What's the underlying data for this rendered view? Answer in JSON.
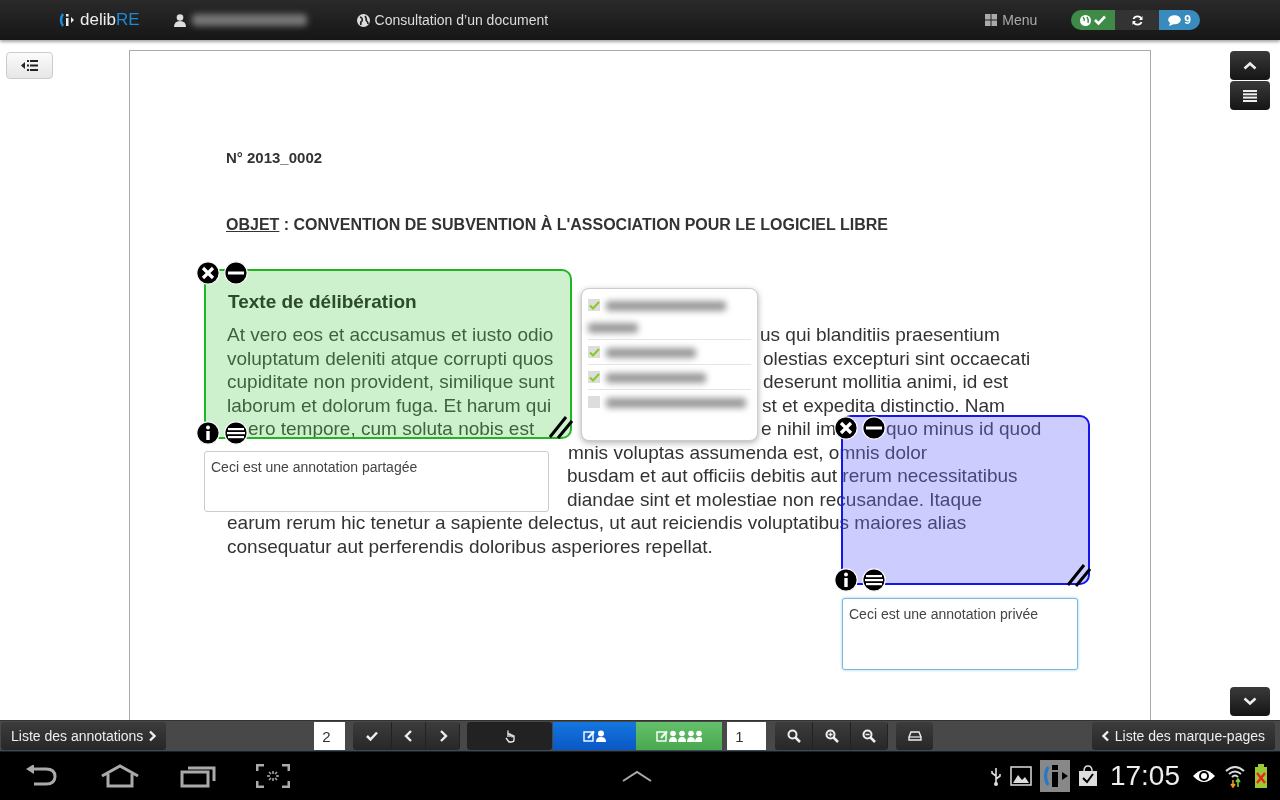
{
  "top_bar": {
    "logo": "delib",
    "logo_accent": "RE",
    "page_title": "Consultation d’un document",
    "menu": "Menu",
    "message_count": "9"
  },
  "document": {
    "number": "N° 2013_0002",
    "subject_label": "OBJET",
    "subject": " : CONVENTION DE SUBVENTION À L'ASSOCIATION POUR LE LOGICIEL LIBRE",
    "lines": [
      [
        "At vero eos et accusamus et iusto odio",
        "us qui blanditiis praesentium"
      ],
      [
        "voluptatum deleniti atque corrupti quos",
        "olestias excepturi sint occaecati"
      ],
      [
        "cupiditate non provident, similique sunt",
        "deserunt mollitia animi, id est"
      ],
      [
        "laborum et dolorum fuga. Et harum qui",
        "st et expedita distinctio. Nam"
      ],
      [
        "ero tempore, cum soluta nobis est",
        "e nihil im",
        "quo minus id quod"
      ],
      [
        "mnis voluptas assumenda est, omnis dolor"
      ],
      [
        "busdam et aut officiis debitis aut rerum necessitatibus"
      ],
      [
        "diandae sint et molestiae non recusandae. Itaque"
      ],
      [
        "earum rerum hic tenetur a sapiente delectus, ut aut reiciendis voluptatibus maiores alias"
      ],
      [
        "consequatur aut perferendis doloribus asperiores repellat."
      ]
    ]
  },
  "annotations": [
    {
      "kind": "shared",
      "title": "Texte de délibération",
      "note": "Ceci est une annotation partagée"
    },
    {
      "kind": "private",
      "note": "Ceci est une annotation privée"
    }
  ],
  "recipients_popup": {
    "people": [
      {
        "checked": true
      },
      {
        "checked": true
      },
      {
        "checked": true
      },
      {
        "checked": false
      }
    ]
  },
  "toolbar": {
    "annotations_button": "Liste des annotations",
    "page_field": "2",
    "zoom_field": "1",
    "bookmarks_button": "Liste des marque-pages"
  },
  "system_bar": {
    "time": "17:05"
  }
}
